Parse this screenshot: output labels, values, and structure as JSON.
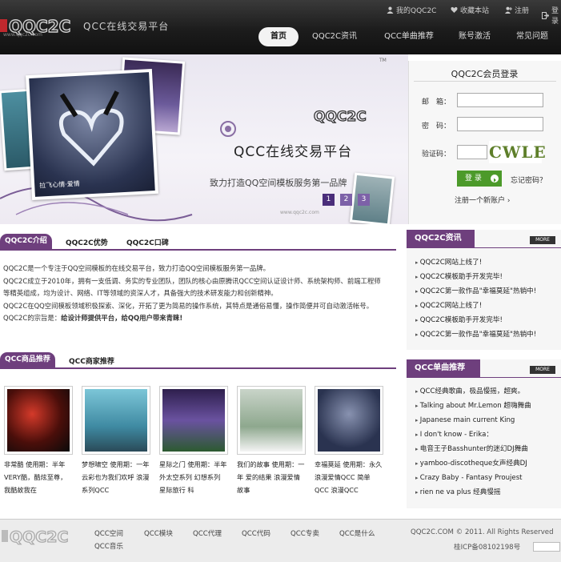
{
  "header": {
    "logo_text": "QQC2C",
    "logo_sub": "www.qqc2c.com",
    "tagline": "QCC在线交易平台",
    "top_links": [
      {
        "label": "我的QQC2C",
        "icon": "user-icon"
      },
      {
        "label": "收藏本站",
        "icon": "heart-icon"
      },
      {
        "label": "注册",
        "icon": "person-add-icon"
      },
      {
        "label": "登录",
        "icon": "login-icon"
      }
    ],
    "nav": [
      "首页",
      "QQC2C资讯",
      "QCC单曲推荐",
      "账号激活",
      "常见问题"
    ]
  },
  "banner": {
    "tm": "TM",
    "brand": "QQC2C",
    "title": "QCC在线交易平台",
    "subtitle": "致力打造QQ空间模板服务第一品牌",
    "url": "www.qqc2c.com",
    "pages": [
      "1",
      "2",
      "3"
    ],
    "active_page": 0,
    "photo_caption": "拉飞心情·爱情"
  },
  "login": {
    "title": "QQC2C会员登录",
    "email_label": "邮　箱：",
    "password_label": "密　码：",
    "captcha_label": "验证码：",
    "captcha_text": "CWLE",
    "login_button": "登 录",
    "forgot": "忘记密码？",
    "register": "注册一个新账户"
  },
  "intro": {
    "tabs": [
      "QQC2C介绍",
      "QQC2C优势",
      "QQC2C口碑"
    ],
    "paragraphs": [
      "QQC2C是一个专注于QQ空间模板的在线交易平台，致力打造QQ空间模板服务第一品牌。",
      "QQC2C成立于2010年，拥有一支低调、务实的专业团队，团队的核心由原腾讯QCC空间认证设计师、系统架构师、前端工程师等精英组成，均为设计、网络、IT等领域的资深人才，具备强大的技术研发能力和创新精神。",
      "QQC2C在QQ空间模板领域积极探索、深化，开拓了更为简易的操作系统，其特点是通俗易懂，操作简便并可自动激活帐号。"
    ],
    "motto_prefix": "QQC2C的宗旨是：",
    "motto": "给设计师提供平台，给QQ用户带来青睐!"
  },
  "news": {
    "title": "QQC2C资讯",
    "more": "MORE",
    "items": [
      "QQC2C网站上线了!",
      "QQC2C模板助手开发完毕!",
      "QQC2C第一款作品\"幸福莫延\"热销中!",
      "QQC2C网站上线了!",
      "QQC2C模板助手开发完毕!",
      "QQC2C第一款作品\"幸福莫延\"热销中!"
    ]
  },
  "songs": {
    "title": "QCC单曲推荐",
    "more": "MORE",
    "items": [
      "QCC经典歌曲，极品慢摇，超爽。",
      "Talking about Mr.Lemon 超嗨舞曲",
      "Japanese main current King",
      "I don't know - Erika：",
      "电音王子Basshunter的迷幻DJ舞曲",
      "yamboo-discotheque女声经典DJ",
      "Crazy Baby - Fantasy Proujest",
      "rien ne va plus 经典慢摇"
    ]
  },
  "products": {
    "tabs": [
      "QCC商品推荐",
      "QCC商家推荐"
    ],
    "items": [
      {
        "caption": "非常酷 使用期：半年 VERY酷，酷炫至尊，我酷故我在"
      },
      {
        "caption": "梦想啸空 使用期：一年 云彩也为我们欢呼 浪漫系列QCC"
      },
      {
        "caption": "星际之门 使用期：半年 外太空系列 幻想系列 星际旅行 科"
      },
      {
        "caption": "我们的故事 使用期：一年 爱的结果 浪漫爱情故事"
      },
      {
        "caption": "幸福莫延 使用期：永久 浪漫爱情QCC 简单QCC 浪漫QCC"
      }
    ]
  },
  "footer": {
    "logo_text": "QQC2C",
    "links_row1": [
      "QCC空间",
      "QCC模块",
      "QCC代理",
      "QCC代码",
      "QCC专卖",
      "QCC是什么"
    ],
    "links_row2": [
      "QCC音乐"
    ],
    "copyright": "QQC2C.COM © 2011. All Rights Reserved",
    "icp": "桂ICP备08102198号"
  },
  "colors": {
    "accent": "#6e3f7d",
    "header_bg": "#1c1c1c",
    "login_green": "#4c9a2a"
  }
}
